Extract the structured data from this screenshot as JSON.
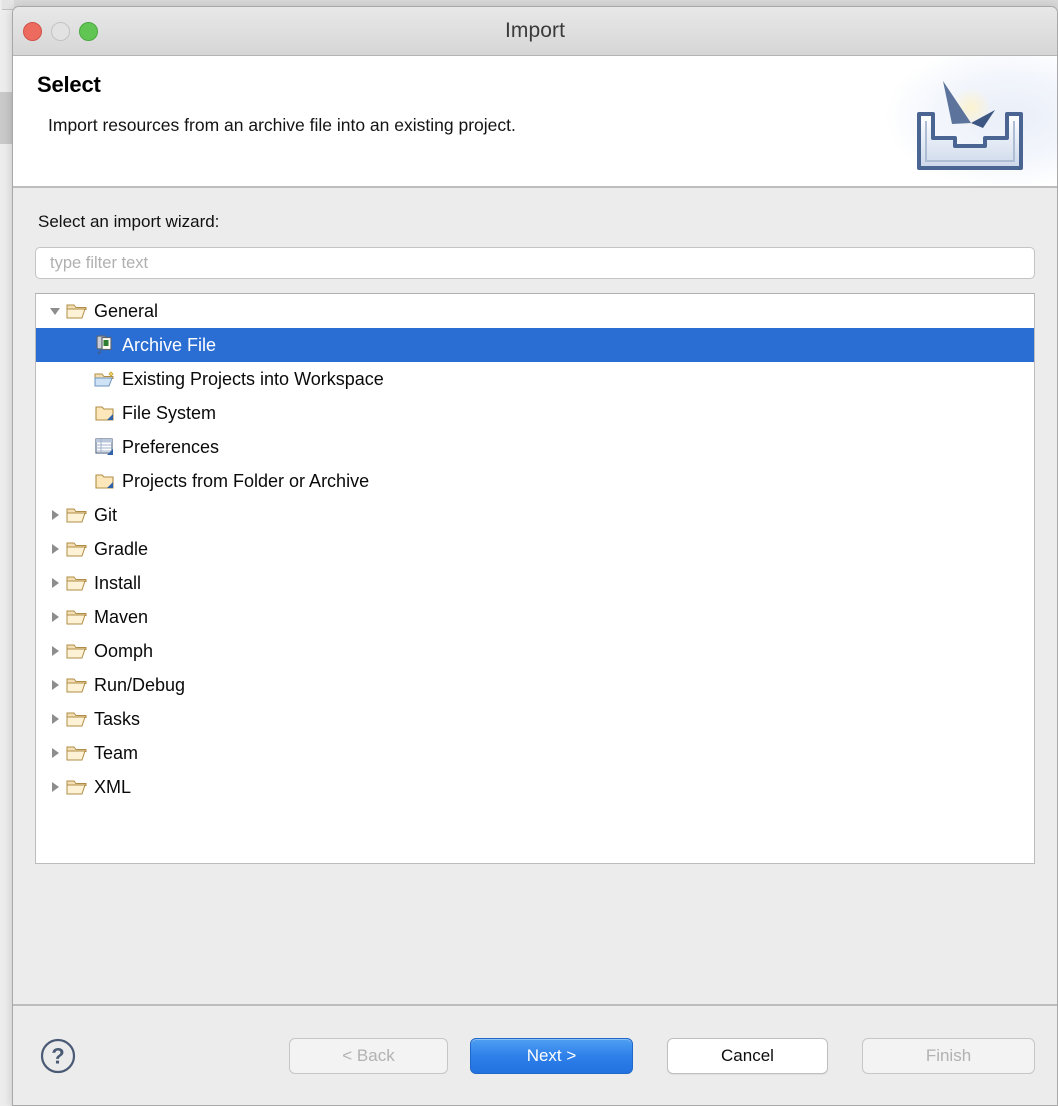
{
  "window": {
    "title": "Import",
    "traffic_lights": [
      {
        "name": "close-button",
        "color": "#ed6a5e"
      },
      {
        "name": "minimize-button",
        "color": "#e2e2e2"
      },
      {
        "name": "zoom-button",
        "color": "#61c554"
      }
    ]
  },
  "header": {
    "title": "Select",
    "description": "Import resources from an archive file into an existing project.",
    "icon": "import-wizard-icon"
  },
  "form": {
    "label": "Select an import wizard:",
    "filter_placeholder": "type filter text",
    "filter_value": ""
  },
  "tree": {
    "items": [
      {
        "label": "General",
        "level": 0,
        "expanded": true,
        "icon": "open-folder-icon",
        "selected": false
      },
      {
        "label": "Archive File",
        "level": 1,
        "expanded": null,
        "icon": "archive-file-icon",
        "selected": true
      },
      {
        "label": "Existing Projects into Workspace",
        "level": 1,
        "expanded": null,
        "icon": "existing-projects-icon",
        "selected": false
      },
      {
        "label": "File System",
        "level": 1,
        "expanded": null,
        "icon": "folder-icon",
        "selected": false
      },
      {
        "label": "Preferences",
        "level": 1,
        "expanded": null,
        "icon": "preferences-icon",
        "selected": false
      },
      {
        "label": "Projects from Folder or Archive",
        "level": 1,
        "expanded": null,
        "icon": "folder-icon",
        "selected": false
      },
      {
        "label": "Git",
        "level": 0,
        "expanded": false,
        "icon": "open-folder-icon",
        "selected": false
      },
      {
        "label": "Gradle",
        "level": 0,
        "expanded": false,
        "icon": "open-folder-icon",
        "selected": false
      },
      {
        "label": "Install",
        "level": 0,
        "expanded": false,
        "icon": "open-folder-icon",
        "selected": false
      },
      {
        "label": "Maven",
        "level": 0,
        "expanded": false,
        "icon": "open-folder-icon",
        "selected": false
      },
      {
        "label": "Oomph",
        "level": 0,
        "expanded": false,
        "icon": "open-folder-icon",
        "selected": false
      },
      {
        "label": "Run/Debug",
        "level": 0,
        "expanded": false,
        "icon": "open-folder-icon",
        "selected": false
      },
      {
        "label": "Tasks",
        "level": 0,
        "expanded": false,
        "icon": "open-folder-icon",
        "selected": false
      },
      {
        "label": "Team",
        "level": 0,
        "expanded": false,
        "icon": "open-folder-icon",
        "selected": false
      },
      {
        "label": "XML",
        "level": 0,
        "expanded": false,
        "icon": "open-folder-icon",
        "selected": false
      }
    ],
    "selection_color": "#2a6ed4"
  },
  "footer": {
    "help_icon": "help-question-icon",
    "buttons": [
      {
        "name": "back-button",
        "label": "< Back",
        "enabled": false,
        "default": false
      },
      {
        "name": "next-button",
        "label": "Next >",
        "enabled": true,
        "default": true
      },
      {
        "name": "cancel-button",
        "label": "Cancel",
        "enabled": true,
        "default": false
      },
      {
        "name": "finish-button",
        "label": "Finish",
        "enabled": false,
        "default": false
      }
    ]
  }
}
